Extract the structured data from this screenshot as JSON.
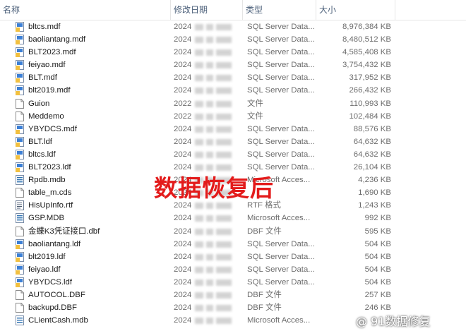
{
  "columns": {
    "name": "名称",
    "date": "修改日期",
    "type": "类型",
    "size": "大小"
  },
  "files": [
    {
      "name": "bltcs.mdf",
      "date": "2024",
      "type": "SQL Server Data...",
      "size": "8,976,384 KB",
      "icon": "sql-server-database-icon"
    },
    {
      "name": "baoliantang.mdf",
      "date": "2024",
      "type": "SQL Server Data...",
      "size": "8,480,512 KB",
      "icon": "sql-server-database-icon"
    },
    {
      "name": "BLT2023.mdf",
      "date": "2024",
      "type": "SQL Server Data...",
      "size": "4,585,408 KB",
      "icon": "sql-server-database-icon"
    },
    {
      "name": "feiyao.mdf",
      "date": "2024",
      "type": "SQL Server Data...",
      "size": "3,754,432 KB",
      "icon": "sql-server-database-icon"
    },
    {
      "name": "BLT.mdf",
      "date": "2024",
      "type": "SQL Server Data...",
      "size": "317,952 KB",
      "icon": "sql-server-database-icon"
    },
    {
      "name": "blt2019.mdf",
      "date": "2024",
      "type": "SQL Server Data...",
      "size": "266,432 KB",
      "icon": "sql-server-database-icon"
    },
    {
      "name": "Guion",
      "date": "2022",
      "type": "文件",
      "size": "110,993 KB",
      "icon": "blank-file-icon"
    },
    {
      "name": "Meddemo",
      "date": "2022",
      "type": "文件",
      "size": "102,484 KB",
      "icon": "blank-file-icon"
    },
    {
      "name": "YBYDCS.mdf",
      "date": "2024",
      "type": "SQL Server Data...",
      "size": "88,576 KB",
      "icon": "sql-server-database-icon"
    },
    {
      "name": "BLT.ldf",
      "date": "2024",
      "type": "SQL Server Data...",
      "size": "64,632 KB",
      "icon": "sql-server-log-icon"
    },
    {
      "name": "bltcs.ldf",
      "date": "2024",
      "type": "SQL Server Data...",
      "size": "64,632 KB",
      "icon": "sql-server-log-icon"
    },
    {
      "name": "BLT2023.ldf",
      "date": "2024",
      "type": "SQL Server Data...",
      "size": "26,104 KB",
      "icon": "sql-server-log-icon"
    },
    {
      "name": "Rpdb.mdb",
      "date": "2024",
      "type": "Microsoft Acces...",
      "size": "4,236 KB",
      "icon": "access-database-icon"
    },
    {
      "name": "table_m.cds",
      "date": "2024",
      "type": "",
      "size": "1,690 KB",
      "icon": "blank-file-icon"
    },
    {
      "name": "HisUpInfo.rtf",
      "date": "2024",
      "type": "RTF 格式",
      "size": "1,243 KB",
      "icon": "rtf-document-icon"
    },
    {
      "name": "GSP.MDB",
      "date": "2024",
      "type": "Microsoft Acces...",
      "size": "992 KB",
      "icon": "access-database-icon"
    },
    {
      "name": "金蝶K3凭证接口.dbf",
      "date": "2024",
      "type": "DBF 文件",
      "size": "595 KB",
      "icon": "blank-file-icon"
    },
    {
      "name": "baoliantang.ldf",
      "date": "2024",
      "type": "SQL Server Data...",
      "size": "504 KB",
      "icon": "sql-server-log-icon"
    },
    {
      "name": "blt2019.ldf",
      "date": "2024",
      "type": "SQL Server Data...",
      "size": "504 KB",
      "icon": "sql-server-log-icon"
    },
    {
      "name": "feiyao.ldf",
      "date": "2024",
      "type": "SQL Server Data...",
      "size": "504 KB",
      "icon": "sql-server-log-icon"
    },
    {
      "name": "YBYDCS.ldf",
      "date": "2024",
      "type": "SQL Server Data...",
      "size": "504 KB",
      "icon": "sql-server-log-icon"
    },
    {
      "name": "AUTOCOL.DBF",
      "date": "2024",
      "type": "DBF 文件",
      "size": "257 KB",
      "icon": "blank-file-icon"
    },
    {
      "name": "backupd.DBF",
      "date": "2024",
      "type": "DBF 文件",
      "size": "246 KB",
      "icon": "blank-file-icon"
    },
    {
      "name": "CLientCash.mdb",
      "date": "2024",
      "type": "Microsoft Acces...",
      "size": "",
      "icon": "access-database-icon"
    }
  ],
  "overlay_text": "数据恢复后",
  "watermark_text": "@ 91数据修复",
  "colors": {
    "overlay": "#e31b1b",
    "header_text": "#4c607a",
    "sql_icon": "#3b7fd6",
    "sql_icon_accent": "#f2c040",
    "access_icon": "#2a6fb0"
  }
}
